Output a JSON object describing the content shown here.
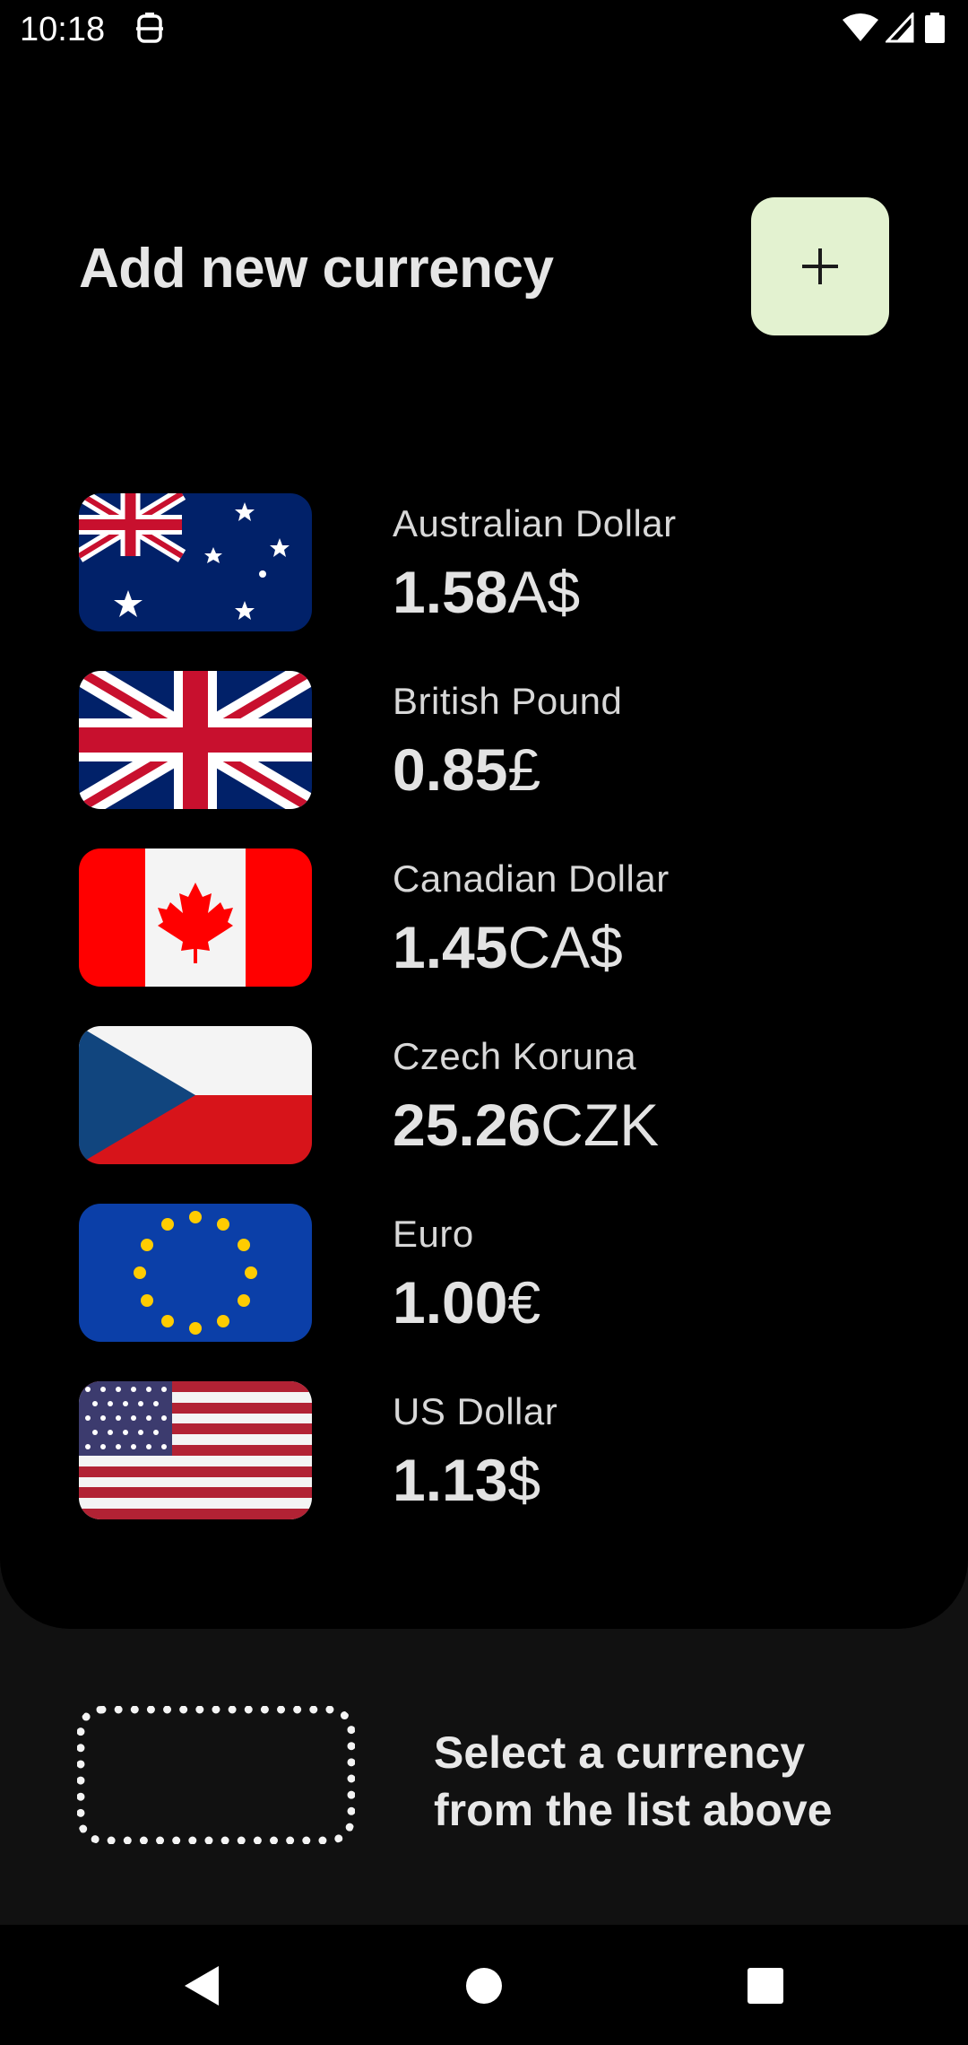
{
  "status_bar": {
    "time": "10:18",
    "app_icon": "notification-app-icon",
    "icons": [
      "wifi-icon",
      "signal-icon",
      "battery-icon"
    ]
  },
  "header": {
    "title": "Add new currency",
    "add_button_icon": "plus-icon",
    "add_button_color": "#e3f2d0"
  },
  "currencies": [
    {
      "name": "Australian Dollar",
      "value": "1.58",
      "symbol": "A$",
      "flag": "australia-flag-icon"
    },
    {
      "name": "British Pound",
      "value": "0.85",
      "symbol": "£",
      "flag": "uk-flag-icon"
    },
    {
      "name": "Canadian Dollar",
      "value": "1.45",
      "symbol": "CA$",
      "flag": "canada-flag-icon"
    },
    {
      "name": "Czech Koruna",
      "value": "25.26",
      "symbol": "CZK",
      "flag": "czech-flag-icon"
    },
    {
      "name": "Euro",
      "value": "1.00",
      "symbol": "€",
      "flag": "eu-flag-icon"
    },
    {
      "name": "US Dollar",
      "value": "1.13",
      "symbol": "$",
      "flag": "us-flag-icon"
    }
  ],
  "selection": {
    "hint": "Select a currency from the list above"
  },
  "nav_bar": {
    "buttons": [
      "back-icon",
      "home-icon",
      "recents-icon"
    ]
  }
}
